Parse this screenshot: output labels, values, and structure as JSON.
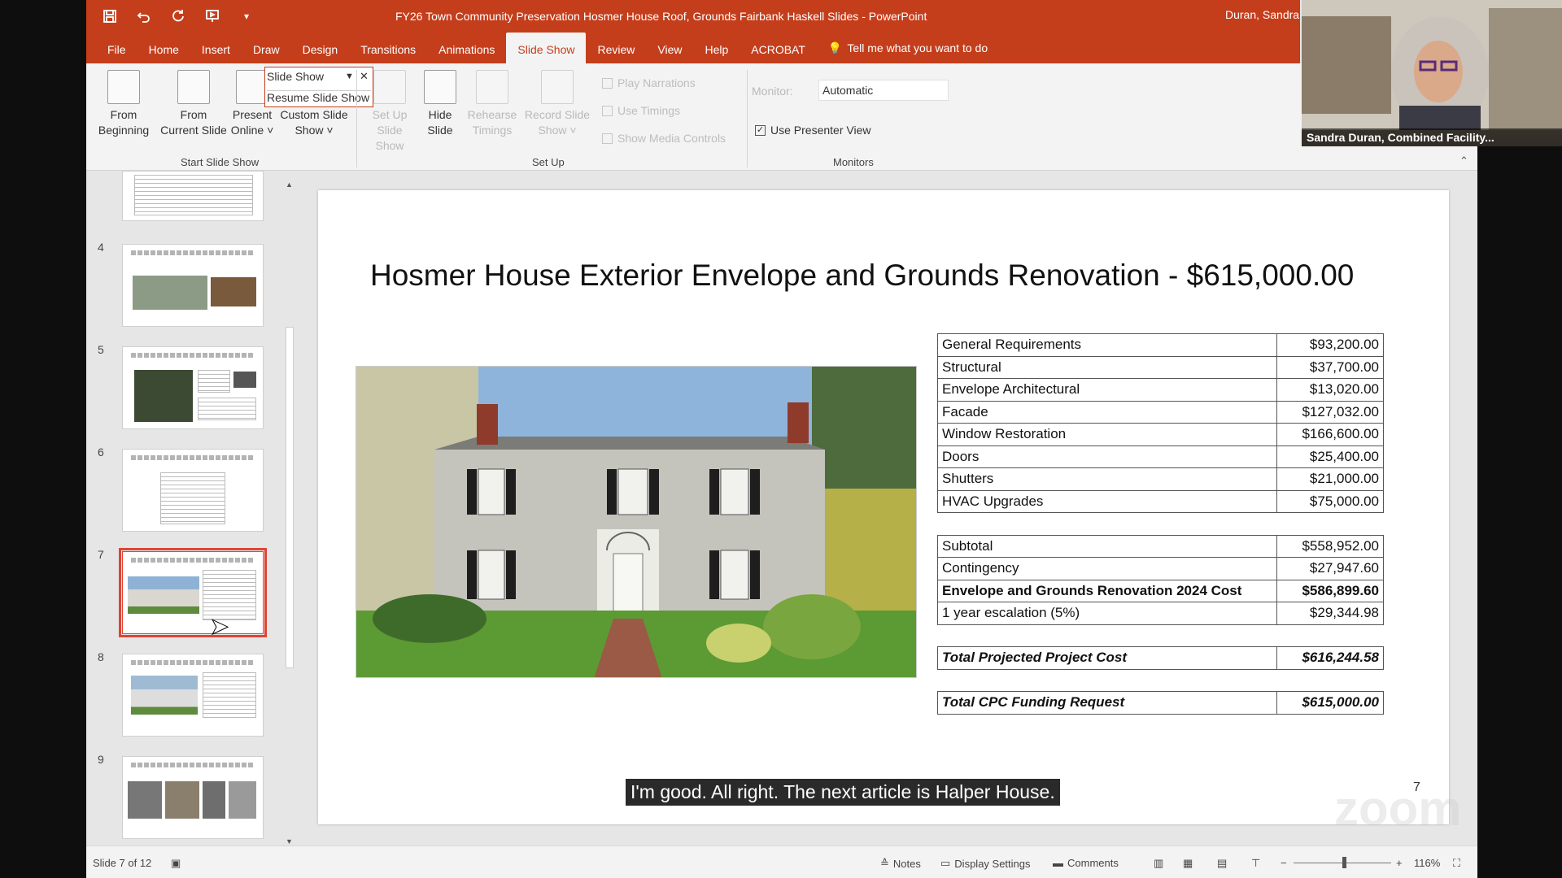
{
  "window": {
    "title": "FY26 Town Community Preservation Hosmer House Roof, Grounds Fairbank Haskell  Slides  -  PowerPoint",
    "user": "Duran, Sandra"
  },
  "tabs": [
    "File",
    "Home",
    "Insert",
    "Draw",
    "Design",
    "Transitions",
    "Animations",
    "Slide Show",
    "Review",
    "View",
    "Help",
    "ACROBAT"
  ],
  "active_tab": "Slide Show",
  "tell_me": "Tell me what you want to do",
  "ribbon": {
    "from_beginning": "From\nBeginning",
    "from_current": "From\nCurrent Slide",
    "present_online": "Present\nOnline ˅",
    "custom_slide_show": "Custom Slide\nShow ˅",
    "popup_slide_show": "Slide Show",
    "popup_resume": "Resume Slide Show",
    "set_up": "Set Up\nSlide Show",
    "hide_slide": "Hide\nSlide",
    "rehearse": "Rehearse\nTimings",
    "record": "Record Slide\nShow ˅",
    "play_narrations": "Play Narrations",
    "use_timings": "Use Timings",
    "show_media_controls": "Show Media Controls",
    "monitor_label": "Monitor:",
    "monitor_value": "Automatic",
    "use_presenter_view": "Use Presenter View",
    "group_start": "Start Slide Show",
    "group_setup": "Set Up",
    "group_monitors": "Monitors"
  },
  "thumbnails": [
    {
      "num": "",
      "selected": false
    },
    {
      "num": "4",
      "selected": false
    },
    {
      "num": "5",
      "selected": false
    },
    {
      "num": "6",
      "selected": false
    },
    {
      "num": "7",
      "selected": true
    },
    {
      "num": "8",
      "selected": false
    },
    {
      "num": "9",
      "selected": false
    }
  ],
  "slide": {
    "title": "Hosmer House Exterior Envelope and Grounds Renovation - $615,000.00",
    "number": "7",
    "table": [
      {
        "label": "General Requirements",
        "amount": "$93,200.00"
      },
      {
        "label": "Structural",
        "amount": "$37,700.00"
      },
      {
        "label": "Envelope Architectural",
        "amount": "$13,020.00"
      },
      {
        "label": "Facade",
        "amount": "$127,032.00"
      },
      {
        "label": "Window Restoration",
        "amount": "$166,600.00"
      },
      {
        "label": "Doors",
        "amount": "$25,400.00"
      },
      {
        "label": "Shutters",
        "amount": "$21,000.00"
      },
      {
        "label": "HVAC Upgrades",
        "amount": "$75,000.00"
      },
      {
        "label": "",
        "amount": ""
      },
      {
        "label": "Subtotal",
        "amount": "$558,952.00"
      },
      {
        "label": "Contingency",
        "amount": "$27,947.60"
      },
      {
        "label": "Envelope and Grounds Renovation 2024 Cost",
        "amount": "$586,899.60"
      },
      {
        "label": "1 year escalation (5%)",
        "amount": "$29,344.98"
      },
      {
        "label": "",
        "amount": ""
      },
      {
        "label": "Total Projected Project Cost",
        "amount": "$616,244.58"
      },
      {
        "label": "",
        "amount": ""
      },
      {
        "label": "Total CPC Funding Request",
        "amount": "$615,000.00"
      }
    ]
  },
  "caption": "I'm good. All right. The next article is Halper House.",
  "status": {
    "slide_of": "Slide 7 of 12",
    "notes": "Notes",
    "display_settings": "Display Settings",
    "comments": "Comments",
    "zoom": "116%"
  },
  "webcam": {
    "name": "Sandra Duran, Combined Facility..."
  },
  "colors": {
    "accent": "#c43e1c",
    "ribbon_bg": "#f3f3f3",
    "selected_outline": "#e04434"
  }
}
